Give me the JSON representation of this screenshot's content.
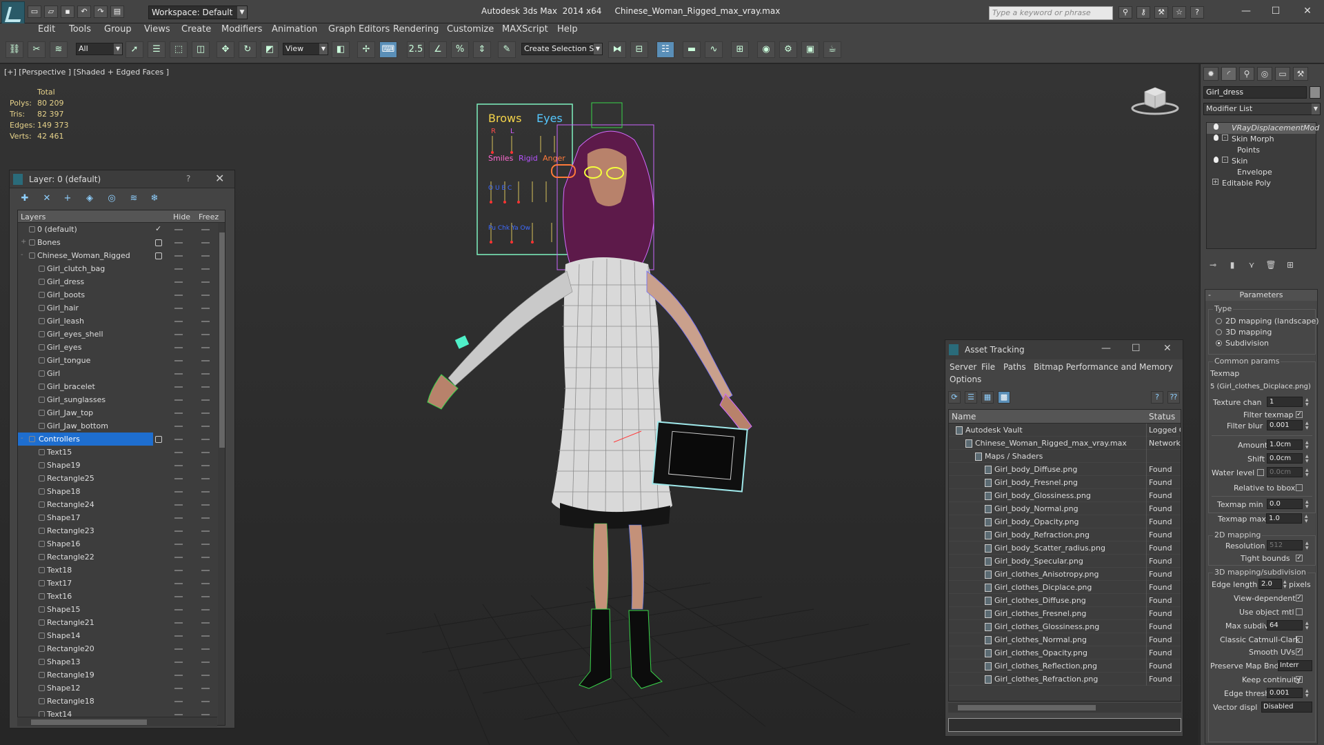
{
  "titlebar": {
    "workspace": "Workspace: Default",
    "app": "Autodesk 3ds Max  2014 x64",
    "file": "Chinese_Woman_Rigged_max_vray.max",
    "search_placeholder": "Type a keyword or phrase"
  },
  "menus": [
    "Edit",
    "Tools",
    "Group",
    "Views",
    "Create",
    "Modifiers",
    "Animation",
    "Graph Editors",
    "Rendering",
    "Customize",
    "MAXScript",
    "Help"
  ],
  "toolbar": {
    "filter": "All",
    "ref_coord": "View",
    "selection_set": "Create Selection Se",
    "snap_label": "2.5"
  },
  "viewport": {
    "label": "[+] [Perspective ] [Shaded + Edged Faces ]",
    "stats_header": "Total",
    "stats": [
      {
        "k": "Polys:",
        "v": "80 209"
      },
      {
        "k": "Tris:",
        "v": "82 397"
      },
      {
        "k": "Edges:",
        "v": "149 373"
      },
      {
        "k": "Verts:",
        "v": "42 461"
      }
    ],
    "board": {
      "brows": "Brows",
      "eyes": "Eyes",
      "r": "R",
      "l": "L",
      "smiles": "Smiles",
      "rigid": "Rigid",
      "anger": "Anger"
    }
  },
  "layer_panel": {
    "title": "Layer: 0 (default)",
    "help": "?",
    "close": "✕",
    "col_layers": "Layers",
    "col_hide": "Hide",
    "col_freeze": "Freez",
    "rows": [
      {
        "name": "0 (default)",
        "level": 0,
        "check": "✓"
      },
      {
        "name": "Bones",
        "level": 0,
        "box": true,
        "plus": "+"
      },
      {
        "name": "Chinese_Woman_Rigged",
        "level": 0,
        "box": true,
        "plus": "-"
      },
      {
        "name": "Girl_clutch_bag",
        "level": 1
      },
      {
        "name": "Girl_dress",
        "level": 1
      },
      {
        "name": "Girl_boots",
        "level": 1
      },
      {
        "name": "Girl_hair",
        "level": 1
      },
      {
        "name": "Girl_leash",
        "level": 1
      },
      {
        "name": "Girl_eyes_shell",
        "level": 1
      },
      {
        "name": "Girl_eyes",
        "level": 1
      },
      {
        "name": "Girl_tongue",
        "level": 1
      },
      {
        "name": "Girl",
        "level": 1
      },
      {
        "name": "Girl_bracelet",
        "level": 1
      },
      {
        "name": "Girl_sunglasses",
        "level": 1
      },
      {
        "name": "Girl_Jaw_top",
        "level": 1
      },
      {
        "name": "Girl_Jaw_bottom",
        "level": 1
      },
      {
        "name": "Controllers",
        "level": 0,
        "box": true,
        "plus": "-",
        "selected": true
      },
      {
        "name": "Text15",
        "level": 1
      },
      {
        "name": "Shape19",
        "level": 1
      },
      {
        "name": "Rectangle25",
        "level": 1
      },
      {
        "name": "Shape18",
        "level": 1
      },
      {
        "name": "Rectangle24",
        "level": 1
      },
      {
        "name": "Shape17",
        "level": 1
      },
      {
        "name": "Rectangle23",
        "level": 1
      },
      {
        "name": "Shape16",
        "level": 1
      },
      {
        "name": "Rectangle22",
        "level": 1
      },
      {
        "name": "Text18",
        "level": 1
      },
      {
        "name": "Text17",
        "level": 1
      },
      {
        "name": "Text16",
        "level": 1
      },
      {
        "name": "Shape15",
        "level": 1
      },
      {
        "name": "Rectangle21",
        "level": 1
      },
      {
        "name": "Shape14",
        "level": 1
      },
      {
        "name": "Rectangle20",
        "level": 1
      },
      {
        "name": "Shape13",
        "level": 1
      },
      {
        "name": "Rectangle19",
        "level": 1
      },
      {
        "name": "Shape12",
        "level": 1
      },
      {
        "name": "Rectangle18",
        "level": 1
      },
      {
        "name": "Text14",
        "level": 1
      }
    ]
  },
  "asset_panel": {
    "title": "Asset Tracking",
    "menu": [
      "Server",
      "File",
      "Paths",
      "Bitmap Performance and Memory",
      "Options"
    ],
    "col_name": "Name",
    "col_status": "Status",
    "rows": [
      {
        "name": "Autodesk Vault",
        "level": 0,
        "status": "Logged C"
      },
      {
        "name": "Chinese_Woman_Rigged_max_vray.max",
        "level": 1,
        "status": "Network I"
      },
      {
        "name": "Maps / Shaders",
        "level": 2,
        "status": ""
      },
      {
        "name": "Girl_body_Diffuse.png",
        "level": 3,
        "status": "Found"
      },
      {
        "name": "Girl_body_Fresnel.png",
        "level": 3,
        "status": "Found"
      },
      {
        "name": "Girl_body_Glossiness.png",
        "level": 3,
        "status": "Found"
      },
      {
        "name": "Girl_body_Normal.png",
        "level": 3,
        "status": "Found"
      },
      {
        "name": "Girl_body_Opacity.png",
        "level": 3,
        "status": "Found"
      },
      {
        "name": "Girl_body_Refraction.png",
        "level": 3,
        "status": "Found"
      },
      {
        "name": "Girl_body_Scatter_radius.png",
        "level": 3,
        "status": "Found"
      },
      {
        "name": "Girl_body_Specular.png",
        "level": 3,
        "status": "Found"
      },
      {
        "name": "Girl_clothes_Anisotropy.png",
        "level": 3,
        "status": "Found"
      },
      {
        "name": "Girl_clothes_Dicplace.png",
        "level": 3,
        "status": "Found"
      },
      {
        "name": "Girl_clothes_Diffuse.png",
        "level": 3,
        "status": "Found"
      },
      {
        "name": "Girl_clothes_Fresnel.png",
        "level": 3,
        "status": "Found"
      },
      {
        "name": "Girl_clothes_Glossiness.png",
        "level": 3,
        "status": "Found"
      },
      {
        "name": "Girl_clothes_Normal.png",
        "level": 3,
        "status": "Found"
      },
      {
        "name": "Girl_clothes_Opacity.png",
        "level": 3,
        "status": "Found"
      },
      {
        "name": "Girl_clothes_Reflection.png",
        "level": 3,
        "status": "Found"
      },
      {
        "name": "Girl_clothes_Refraction.png",
        "level": 3,
        "status": "Found"
      }
    ]
  },
  "command_panel": {
    "object_name": "Girl_dress",
    "modifier_list": "Modifier List",
    "stack": [
      {
        "label": "VRayDisplacementMod",
        "bulb": true,
        "italic": true,
        "selected": true
      },
      {
        "label": "Skin Morph",
        "bulb": true,
        "expander": "-"
      },
      {
        "label": "Points",
        "sub": true
      },
      {
        "label": "Skin",
        "bulb": true,
        "expander": "-"
      },
      {
        "label": "Envelope",
        "sub": true
      },
      {
        "label": "Editable Poly",
        "expander": "+"
      }
    ],
    "params": {
      "title": "Parameters",
      "type_label": "Type",
      "type_options": [
        "2D mapping (landscape)",
        "3D mapping",
        "Subdivision"
      ],
      "common_label": "Common params",
      "texmap_label": "Texmap",
      "texmap_value": "5 (Girl_clothes_Dicplace.png)",
      "texture_chan_label": "Texture chan",
      "texture_chan": "1",
      "filter_texmap_label": "Filter texmap",
      "filter_blur_label": "Filter blur",
      "filter_blur": "0.001",
      "amount_label": "Amount",
      "amount": "1.0cm",
      "shift_label": "Shift",
      "shift": "0.0cm",
      "water_label": "Water level",
      "water": "0.0cm",
      "relative_label": "Relative to bbox",
      "texmap_min_label": "Texmap min",
      "texmap_min": "0.0",
      "texmap_max_label": "Texmap max",
      "texmap_max": "1.0",
      "mapping2d_label": "2D mapping",
      "resolution_label": "Resolution",
      "resolution": "512",
      "tight_label": "Tight bounds",
      "mapping3d_label": "3D mapping/subdivision",
      "edge_length_label": "Edge length",
      "edge_length": "2.0",
      "pixels_label": "pixels",
      "view_dep_label": "View-dependent",
      "use_obj_label": "Use object mtl",
      "max_subdivs_label": "Max subdivs",
      "max_subdivs": "64",
      "catmull_label": "Classic Catmull-Clark",
      "smooth_uv_label": "Smooth UVs",
      "preserve_label": "Preserve Map Bnd",
      "preserve_value": "Interr",
      "keep_cont_label": "Keep continuity",
      "edge_thresh_label": "Edge thresh",
      "edge_thresh": "0.001",
      "vector_label": "Vector displ",
      "vector_value": "Disabled"
    }
  }
}
